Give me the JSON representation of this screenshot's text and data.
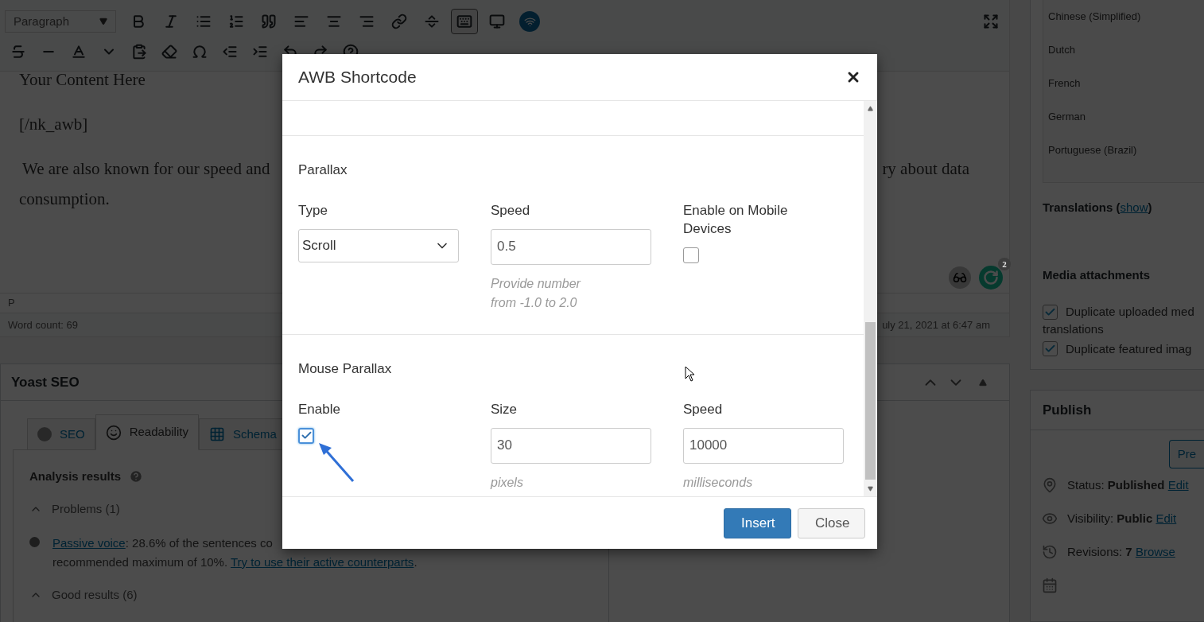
{
  "editor": {
    "format_select": "Paragraph",
    "kitchen_sink_pressed": true,
    "lines": [
      [
        "Your Content Here"
      ],
      [
        "[/nk_awb]"
      ],
      [
        "We are also known for our speed and",
        "ry about data"
      ],
      [
        "consumption."
      ]
    ],
    "path": "P",
    "word_count": "Word count: 69",
    "last_edited": "uly 21, 2021 at 6:47 am",
    "grammarly_count": "2"
  },
  "yoast": {
    "title": "Yoast SEO",
    "tabs": [
      {
        "label": "SEO",
        "selected": false
      },
      {
        "label": "Readability",
        "selected": true
      },
      {
        "label": "Schema",
        "selected": false
      }
    ],
    "analysis_title": "Analysis results",
    "sections": [
      {
        "label": "Problems (1)",
        "expanded": true,
        "items": [
          {
            "link": "Passive voice",
            "text": ": 28.6% of the sentences co",
            "text2": "recommended maximum of 10%. ",
            "link2": "Try to use their active counterparts",
            "end": "."
          }
        ]
      },
      {
        "label": "Good results (6)",
        "expanded": true
      }
    ]
  },
  "sidebar": {
    "languages": [
      "Chinese (Simplified)",
      "Dutch",
      "French",
      "German",
      "Portuguese (Brazil)"
    ],
    "translations": {
      "label": "Translations (",
      "link": "show",
      "end": ")"
    },
    "media_title": "Media attachments",
    "media_options": [
      {
        "lines": [
          "Duplicate uploaded med",
          "translations"
        ],
        "checked": true
      },
      {
        "lines": [
          "Duplicate featured imag"
        ],
        "checked": true
      }
    ]
  },
  "publish": {
    "title": "Publish",
    "preview_button": "Pre",
    "rows": [
      {
        "kind": "status",
        "label": "Status: ",
        "value": "Published",
        "link": "Edit"
      },
      {
        "kind": "visibility",
        "label": "Visibility: ",
        "value": "Public",
        "link": "Edit"
      },
      {
        "kind": "revisions",
        "label": "Revisions: ",
        "value": "7",
        "link": "Browse"
      },
      {
        "kind": "schedule"
      }
    ]
  },
  "modal": {
    "title": "AWB Shortcode",
    "sections": [
      {
        "title": "Parallax",
        "fields": [
          {
            "kind": "select",
            "label": "Type",
            "value": "Scroll"
          },
          {
            "kind": "input",
            "label": "Speed",
            "value": "0.5",
            "hint": "Provide number from -1.0 to 2.0"
          },
          {
            "kind": "checkbox",
            "label": "Enable on Mobile Devices",
            "checked": false
          }
        ]
      },
      {
        "title": "Mouse Parallax",
        "fields": [
          {
            "kind": "checkbox",
            "label": "Enable",
            "checked": true
          },
          {
            "kind": "input",
            "label": "Size",
            "value": "30",
            "hint": "pixels"
          },
          {
            "kind": "input",
            "label": "Speed",
            "value": "10000",
            "hint": "milliseconds"
          }
        ]
      }
    ],
    "buttons": [
      {
        "label": "Insert",
        "kind": "primary"
      },
      {
        "label": "Close",
        "kind": "secondary"
      }
    ]
  }
}
